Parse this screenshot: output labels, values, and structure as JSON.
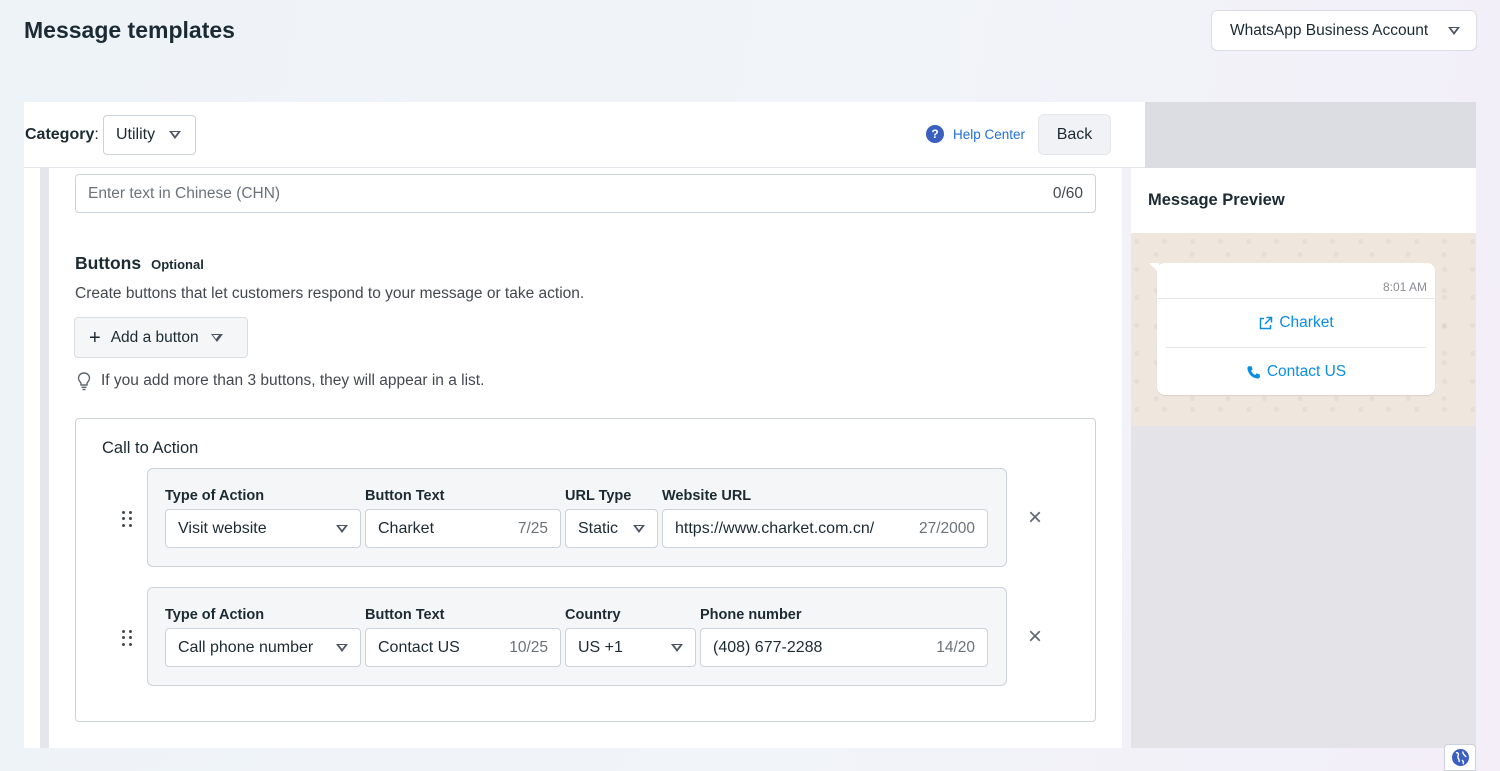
{
  "page": {
    "title": "Message templates"
  },
  "account_selector": {
    "label": "WhatsApp Business Account",
    "icon": "chevron-down-icon"
  },
  "header": {
    "category_label": "Category",
    "category_value": "Utility",
    "help_label": "Help Center",
    "back_label": "Back"
  },
  "footer_field": {
    "placeholder": "Enter text in Chinese (CHN)",
    "counter": "0/60"
  },
  "buttons_section": {
    "heading": "Buttons",
    "optional_tag": "Optional",
    "description": "Create buttons that let customers respond to your message or take action.",
    "add_button_label": "Add a button",
    "hint": "If you add more than 3 buttons, they will appear in a list."
  },
  "call_to_action": {
    "title": "Call to Action",
    "rows": [
      {
        "labels": {
          "type": "Type of Action",
          "text": "Button Text",
          "third": "URL Type",
          "fourth": "Website URL"
        },
        "type_value": "Visit website",
        "text_value": "Charket",
        "text_counter": "7/25",
        "third_value": "Static",
        "fourth_value": "https://www.charket.com.cn/",
        "fourth_counter": "27/2000"
      },
      {
        "labels": {
          "type": "Type of Action",
          "text": "Button Text",
          "third": "Country",
          "fourth": "Phone number"
        },
        "type_value": "Call phone number",
        "text_value": "Contact US",
        "text_counter": "10/25",
        "third_value": "US +1",
        "fourth_value": "(408) 677-2288",
        "fourth_counter": "14/20"
      }
    ]
  },
  "preview": {
    "title": "Message Preview",
    "time": "8:01 AM",
    "buttons": [
      {
        "label": "Charket",
        "icon": "external-link-icon"
      },
      {
        "label": "Contact US",
        "icon": "phone-icon"
      }
    ],
    "accent_color": "#0a8ee0"
  }
}
